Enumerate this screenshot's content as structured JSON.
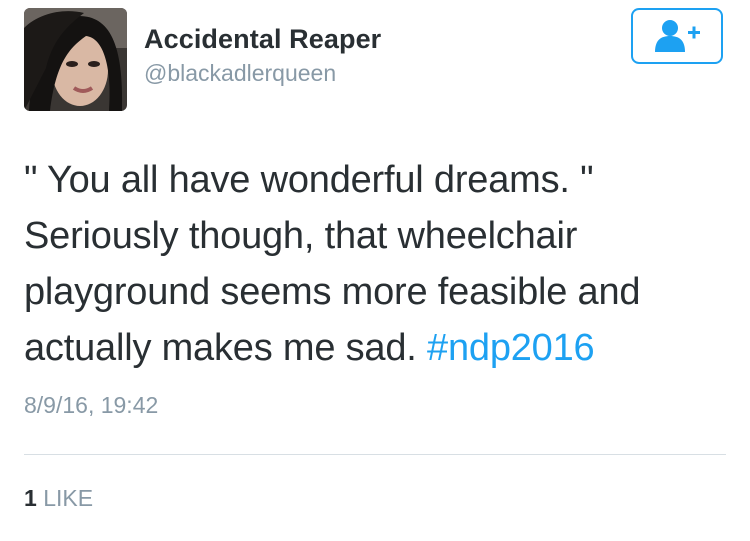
{
  "author": {
    "display_name": "Accidental Reaper",
    "handle": "@blackadlerqueen",
    "avatar_icon": "user-avatar-photo"
  },
  "follow_button": {
    "icon": "follow-user-plus-icon",
    "color": "#1da1f2"
  },
  "tweet": {
    "text_lines": [
      "\" You all have wonderful dreams. \"",
      "Seriously though, that wheelchair",
      "playground seems more feasible and",
      "actually makes me sad. "
    ],
    "hashtag": "#ndp2016",
    "timestamp": "8/9/16, 19:42"
  },
  "stats": {
    "like_count": "1",
    "like_label": "LIKE"
  },
  "colors": {
    "accent": "#1da1f2",
    "text": "#292f33",
    "muted": "#8899a6",
    "divider": "#d8dfe4"
  }
}
